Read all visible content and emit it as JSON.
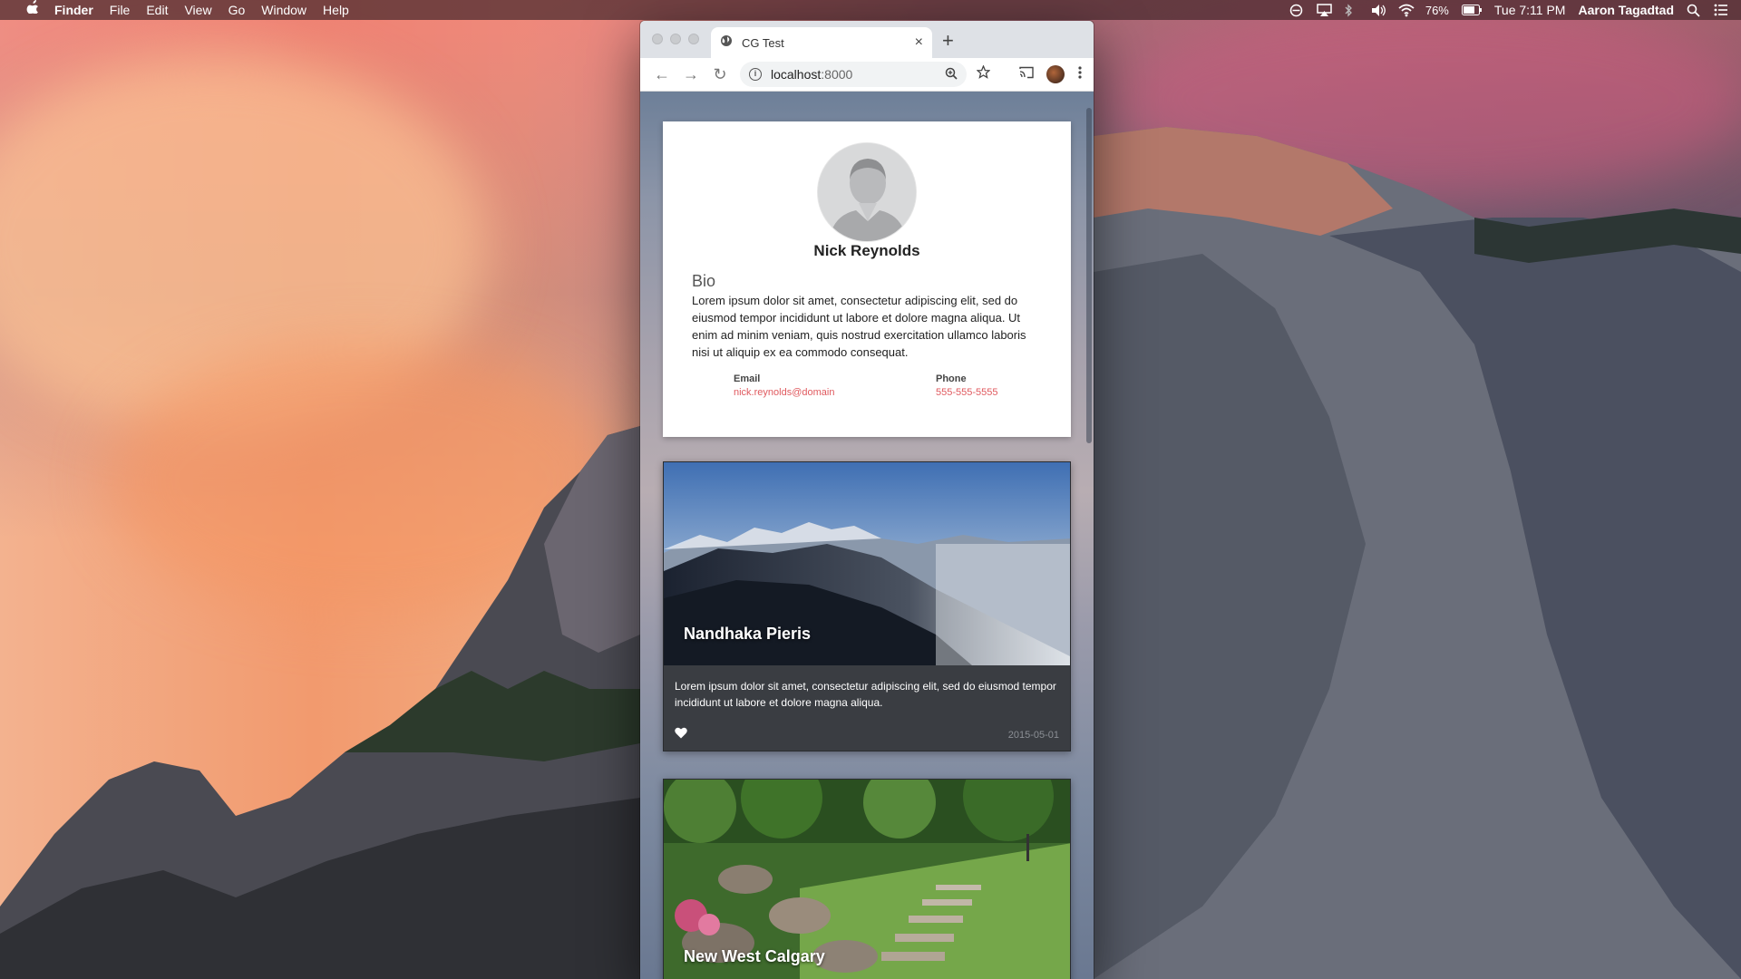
{
  "menubar": {
    "app_name": "Finder",
    "menus": [
      "File",
      "Edit",
      "View",
      "Go",
      "Window",
      "Help"
    ],
    "battery": "76%",
    "clock": "Tue 7:11 PM",
    "user": "Aaron Tagadtad"
  },
  "browser": {
    "tab_title": "CG Test",
    "tab_close": "×",
    "new_tab": "+",
    "url_host": "localhost",
    "url_port": ":8000"
  },
  "profile": {
    "name": "Nick Reynolds",
    "bio_title": "Bio",
    "bio_text": "Lorem ipsum dolor sit amet, consectetur adipiscing elit, sed do eiusmod tempor incididunt ut labore et dolore magna aliqua. Ut enim ad minim veniam, quis nostrud exercitation ullamco laboris nisi ut aliquip ex ea commodo consequat.",
    "email_label": "Email",
    "email_value": "nick.reynolds@domain",
    "phone_label": "Phone",
    "phone_value": "555-555-5555"
  },
  "posts": [
    {
      "title": "Nandhaka Pieris",
      "text": "Lorem ipsum dolor sit amet, consectetur adipiscing elit, sed do eiusmod tempor incididunt ut labore et dolore magna aliqua.",
      "date": "2015-05-01"
    },
    {
      "title": "New West Calgary"
    }
  ],
  "colors": {
    "link": "#e05a5f",
    "card_dark": "#3a3d42"
  }
}
